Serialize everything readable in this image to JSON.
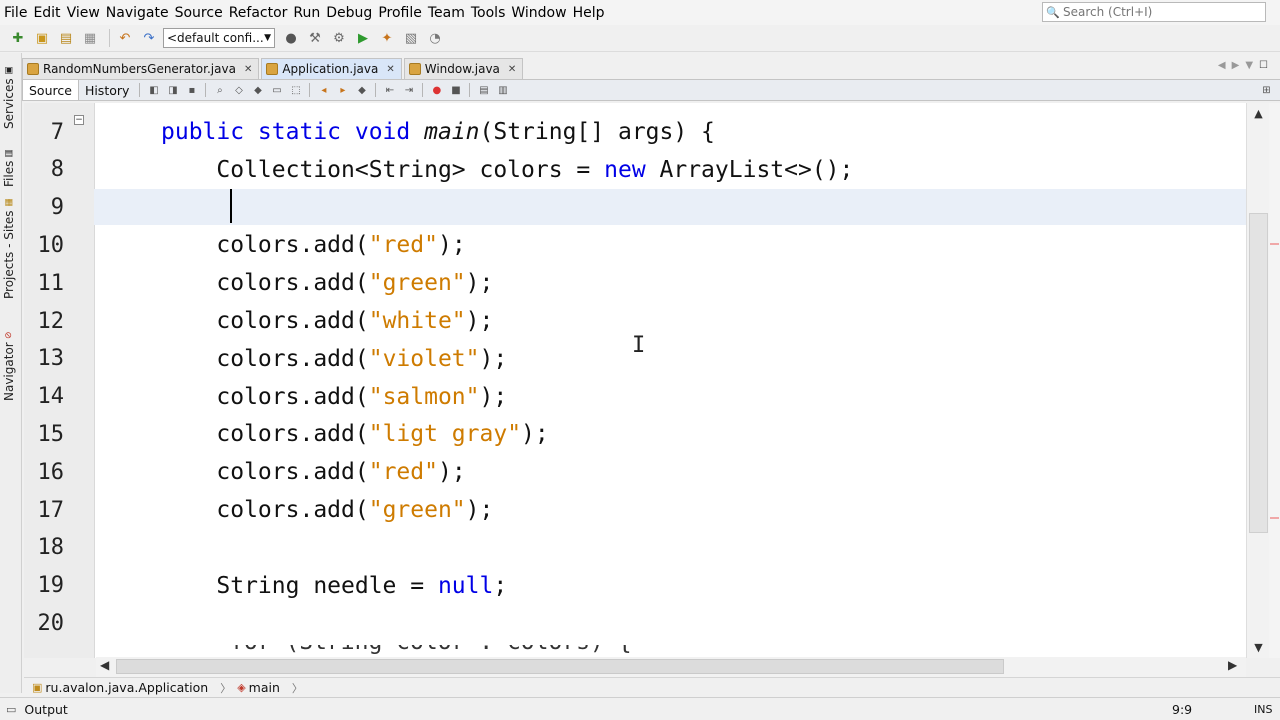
{
  "menu": [
    "File",
    "Edit",
    "View",
    "Navigate",
    "Source",
    "Refactor",
    "Run",
    "Debug",
    "Profile",
    "Team",
    "Tools",
    "Window",
    "Help"
  ],
  "search": {
    "placeholder": "Search (Ctrl+I)"
  },
  "toolbar": {
    "config_value": "<default confi..."
  },
  "left_strip": {
    "tabs": [
      "Services",
      "Files",
      "Projects - Sites",
      "Navigator"
    ]
  },
  "editor_tabs": [
    {
      "label": "RandomNumbersGenerator.java",
      "active": false
    },
    {
      "label": "Application.java",
      "active": true
    },
    {
      "label": "Window.java",
      "active": false
    }
  ],
  "source_bar": {
    "source_label": "Source",
    "history_label": "History"
  },
  "code_lines": [
    {
      "num": "7",
      "indent": "",
      "tokens": [
        {
          "t": "public static void ",
          "c": "kw"
        },
        {
          "t": "main",
          "c": "it"
        },
        {
          "t": "(String[] args) {",
          "c": ""
        }
      ]
    },
    {
      "num": "8",
      "indent": "    ",
      "tokens": [
        {
          "t": "Collection<String> colors = ",
          "c": ""
        },
        {
          "t": "new",
          "c": "kw"
        },
        {
          "t": " ArrayList<>();",
          "c": ""
        }
      ]
    },
    {
      "num": "9",
      "indent": "",
      "tokens": []
    },
    {
      "num": "10",
      "indent": "    ",
      "tokens": [
        {
          "t": "colors.add(",
          "c": ""
        },
        {
          "t": "\"red\"",
          "c": "str"
        },
        {
          "t": ");",
          "c": ""
        }
      ]
    },
    {
      "num": "11",
      "indent": "    ",
      "tokens": [
        {
          "t": "colors.add(",
          "c": ""
        },
        {
          "t": "\"green\"",
          "c": "str"
        },
        {
          "t": ");",
          "c": ""
        }
      ]
    },
    {
      "num": "12",
      "indent": "    ",
      "tokens": [
        {
          "t": "colors.add(",
          "c": ""
        },
        {
          "t": "\"white\"",
          "c": "str"
        },
        {
          "t": ");",
          "c": ""
        }
      ]
    },
    {
      "num": "13",
      "indent": "    ",
      "tokens": [
        {
          "t": "colors.add(",
          "c": ""
        },
        {
          "t": "\"violet\"",
          "c": "str"
        },
        {
          "t": ");",
          "c": ""
        }
      ]
    },
    {
      "num": "14",
      "indent": "    ",
      "tokens": [
        {
          "t": "colors.add(",
          "c": ""
        },
        {
          "t": "\"salmon\"",
          "c": "str"
        },
        {
          "t": ");",
          "c": ""
        }
      ]
    },
    {
      "num": "15",
      "indent": "    ",
      "tokens": [
        {
          "t": "colors.add(",
          "c": ""
        },
        {
          "t": "\"ligt gray\"",
          "c": "str"
        },
        {
          "t": ");",
          "c": ""
        }
      ]
    },
    {
      "num": "16",
      "indent": "    ",
      "tokens": [
        {
          "t": "colors.add(",
          "c": ""
        },
        {
          "t": "\"red\"",
          "c": "str"
        },
        {
          "t": ");",
          "c": ""
        }
      ]
    },
    {
      "num": "17",
      "indent": "    ",
      "tokens": [
        {
          "t": "colors.add(",
          "c": ""
        },
        {
          "t": "\"green\"",
          "c": "str"
        },
        {
          "t": ");",
          "c": ""
        }
      ]
    },
    {
      "num": "18",
      "indent": "",
      "tokens": []
    },
    {
      "num": "19",
      "indent": "    ",
      "tokens": [
        {
          "t": "String needle = ",
          "c": ""
        },
        {
          "t": "null",
          "c": "kw"
        },
        {
          "t": ";",
          "c": ""
        }
      ]
    },
    {
      "num": "20",
      "indent": "",
      "tokens": []
    }
  ],
  "breadcrumb": {
    "class_path": "ru.avalon.java.Application",
    "method": "main"
  },
  "status": {
    "output_label": "Output",
    "position": "9:9",
    "mode": "INS"
  },
  "colors": {
    "keyword": "#0000e6",
    "string": "#ce7b00",
    "current_line": "#e9eff8"
  }
}
